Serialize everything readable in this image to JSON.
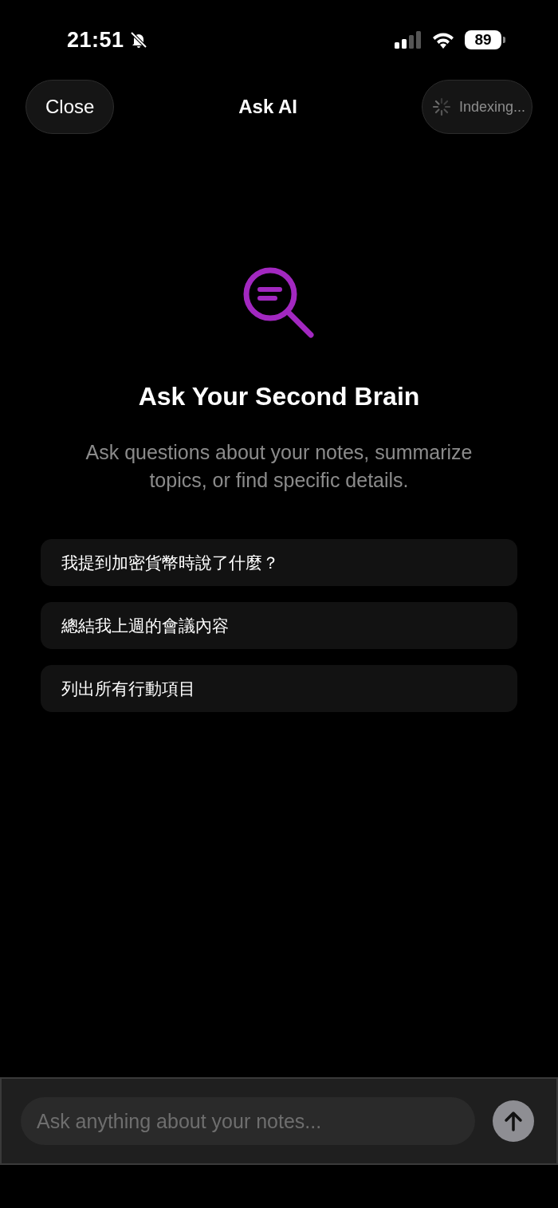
{
  "status_bar": {
    "time": "21:51",
    "silent": true,
    "battery": "89"
  },
  "header": {
    "close": "Close",
    "title": "Ask AI",
    "status": {
      "label": "Indexing...",
      "busy": true
    }
  },
  "empty_state": {
    "title": "Ask Your Second Brain",
    "subtitle": "Ask questions about your notes, summarize topics, or find specific details."
  },
  "suggestions": [
    "我提到加密貨幣時說了什麼？",
    "總結我上週的會議內容",
    "列出所有行動項目"
  ],
  "composer": {
    "placeholder": "Ask anything about your notes...",
    "send_disabled": true
  }
}
